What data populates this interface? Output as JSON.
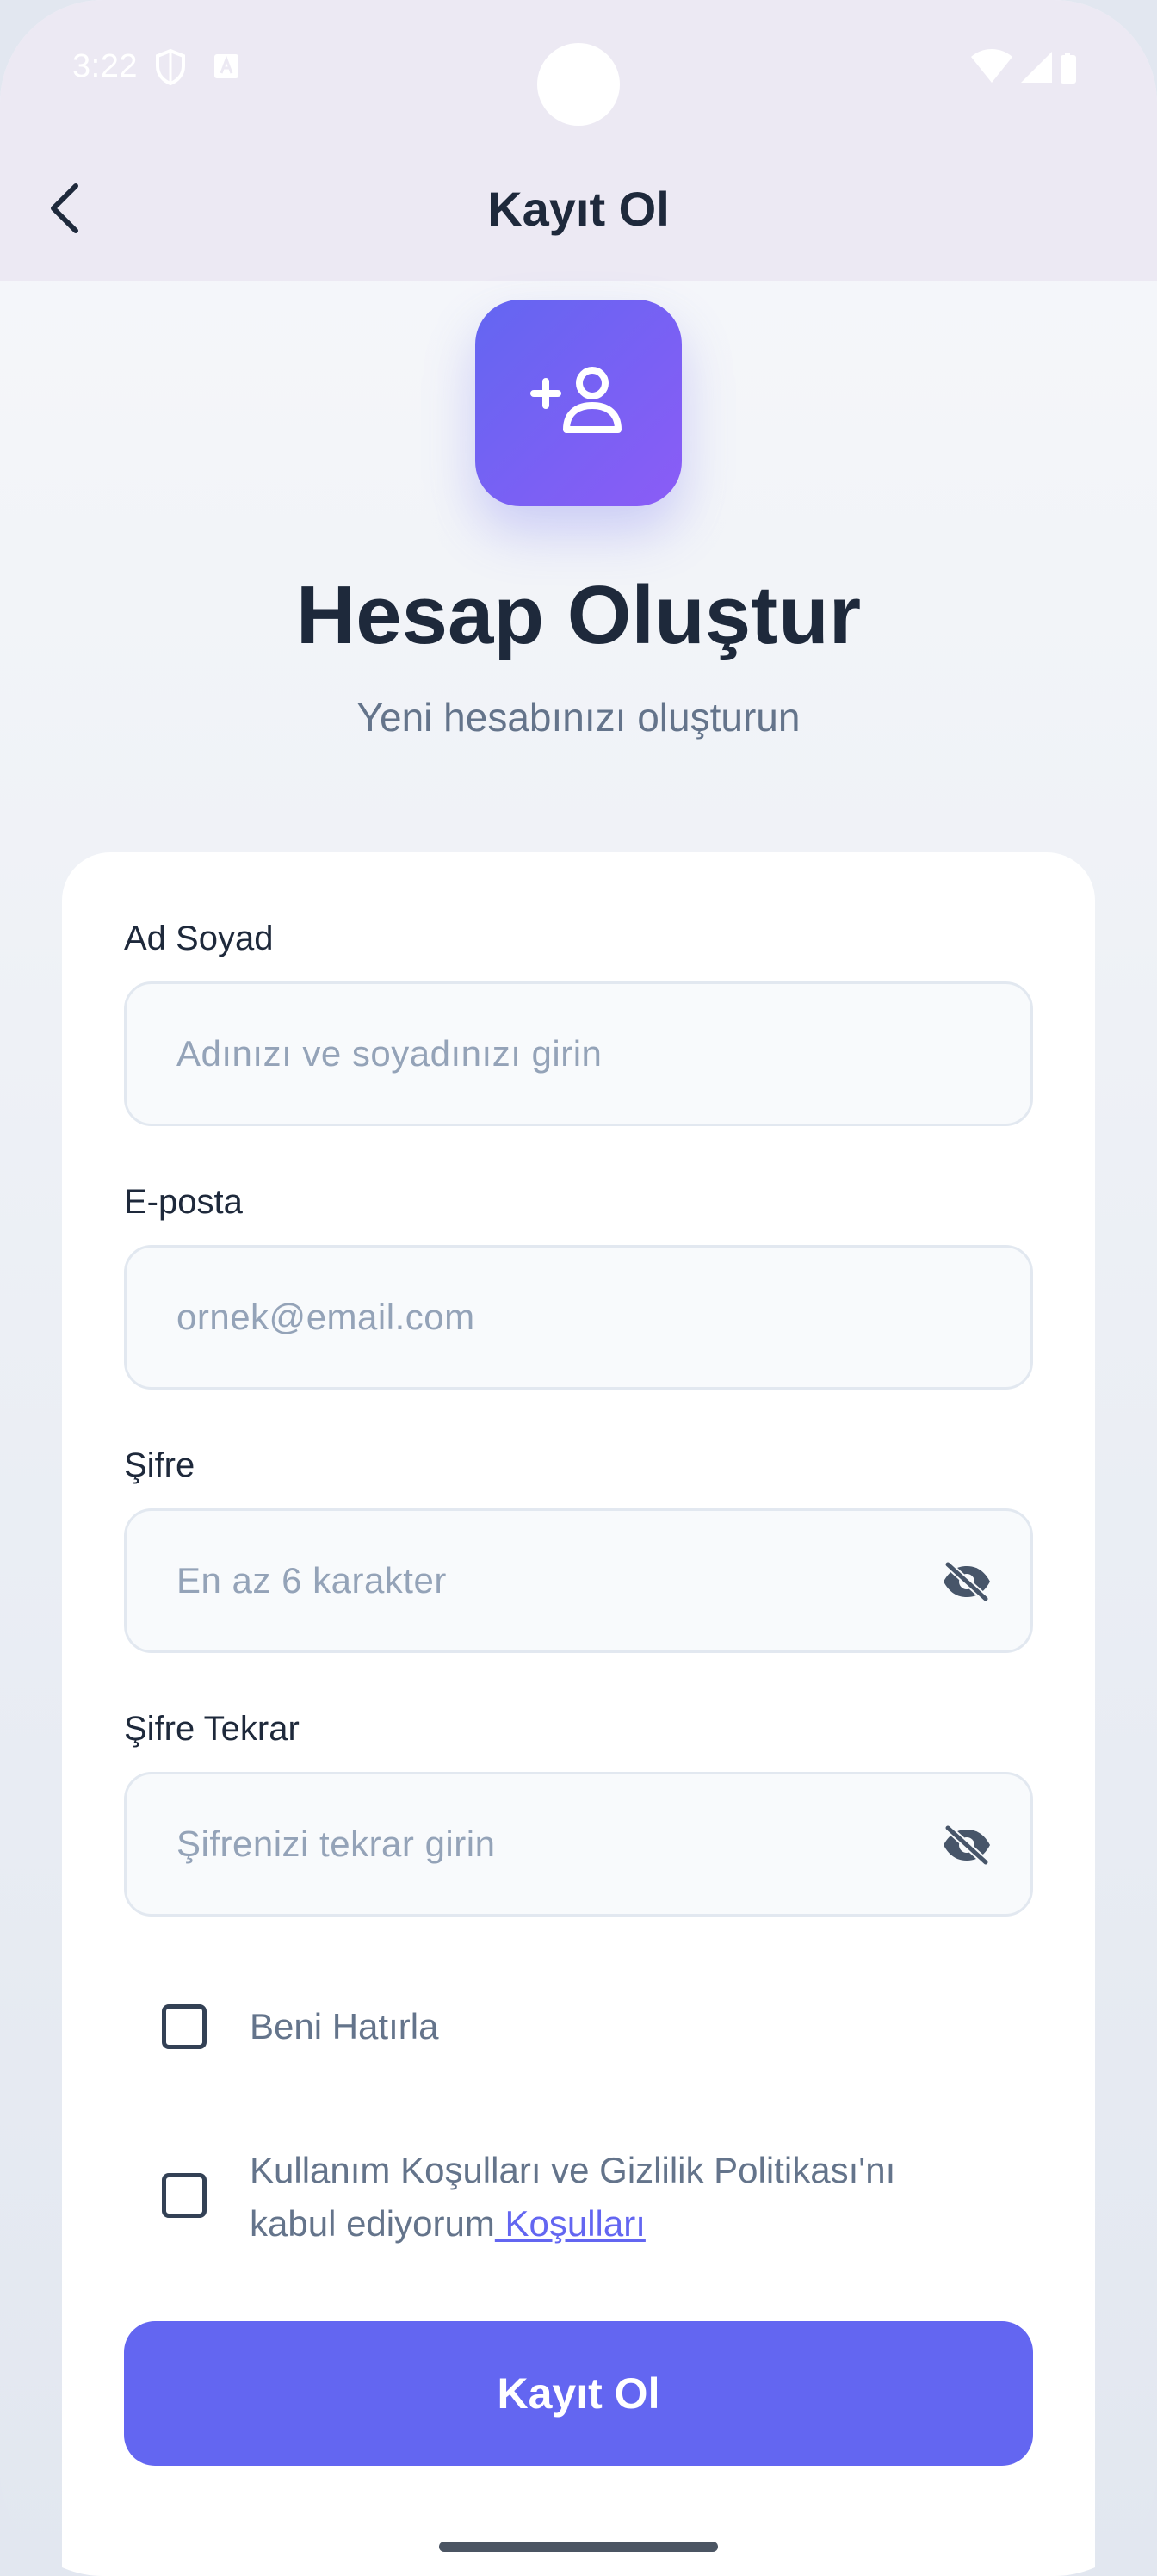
{
  "status_bar": {
    "time": "3:22",
    "icons": [
      "shield-icon",
      "font-a-icon",
      "wifi-icon",
      "signal-icon",
      "battery-icon"
    ]
  },
  "app_bar": {
    "back_icon": "chevron-left-icon",
    "title": "Kayıt Ol"
  },
  "hero": {
    "icon": "person-add-icon",
    "title": "Hesap Oluştur",
    "subtitle": "Yeni hesabınızı oluşturun"
  },
  "form": {
    "name": {
      "label": "Ad Soyad",
      "value": "",
      "placeholder": "Adınızı ve soyadınızı girin"
    },
    "email": {
      "label": "E-posta",
      "value": "",
      "placeholder": "ornek@email.com"
    },
    "password": {
      "label": "Şifre",
      "value": "",
      "placeholder": "En az 6 karakter",
      "toggle_icon": "eye-off-icon"
    },
    "password_repeat": {
      "label": "Şifre Tekrar",
      "value": "",
      "placeholder": "Şifrenizi tekrar girin",
      "toggle_icon": "eye-off-icon"
    },
    "remember_me": {
      "label": "Beni Hatırla",
      "checked": false
    },
    "terms": {
      "label": "Kullanım Koşulları ve Gizlilik Politikası'nı kabul ediyorum",
      "link": " Koşulları",
      "checked": false
    },
    "submit_label": "Kayıt Ol"
  },
  "colors": {
    "accent": "#6366f1",
    "accent_gradient_end": "#8b5cf6",
    "title": "#1e293b",
    "muted": "#64748b",
    "placeholder": "#94a3b8",
    "app_bar_bg": "#ece9f3"
  }
}
